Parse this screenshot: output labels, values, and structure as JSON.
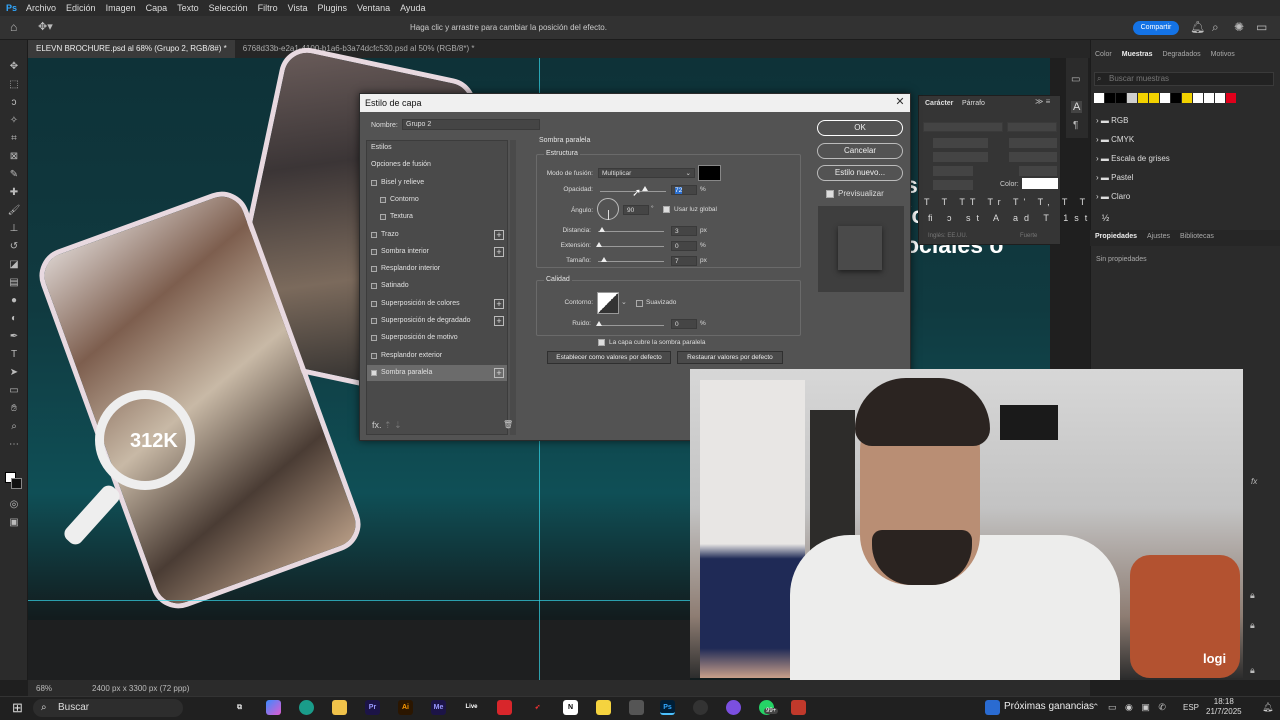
{
  "menubar": {
    "items": [
      "Archivo",
      "Edición",
      "Imagen",
      "Capa",
      "Texto",
      "Selección",
      "Filtro",
      "Vista",
      "Plugins",
      "Ventana",
      "Ayuda"
    ]
  },
  "optbar": {
    "hint": "Haga clic y arrastre para cambiar la posición del efecto.",
    "share_label": "Compartir"
  },
  "tabs": [
    {
      "label": "ELEVN BROCHURE.psd al 68% (Grupo 2, RGB/8#) *",
      "active": true
    },
    {
      "label": "6768d33b-e2a1-4100-b1a6-b3a74dcfc530.psd al 50% (RGB/8*) *",
      "active": false
    }
  ],
  "canvas": {
    "headline": "stas y/o\n/o recursos\nociales o",
    "magnifier_text": "312K"
  },
  "status": {
    "zoom": "68%",
    "size": "2400 px x 3300 px (72 ppp)"
  },
  "right_panel": {
    "tabs": [
      "Color",
      "Muestras",
      "Degradados",
      "Motivos"
    ],
    "active_tab": "Muestras",
    "search_placeholder": "Buscar muestras",
    "swatch_colors": [
      "#ffffff",
      "#000000",
      "#000000",
      "#cfcfcf",
      "#f2d200",
      "#f2d200",
      "#ffffff",
      "#000000",
      "#f2d200",
      "#ffffff",
      "#ffffff",
      "#ffffff",
      "#e0001b"
    ],
    "folders": [
      "RGB",
      "CMYK",
      "Escala de grises",
      "Pastel",
      "Claro"
    ],
    "prop_tabs": [
      "Propiedades",
      "Ajustes",
      "Bibliotecas"
    ],
    "prop_empty": "Sin propiedades"
  },
  "char_panel": {
    "tabs": [
      "Carácter",
      "Párrafo"
    ],
    "color_label": "Color:",
    "lang": "Inglés: EE.UU.",
    "antialias": "Fuerte",
    "glyphs": "T T TT Tr T' T, T T"
  },
  "dialog": {
    "title": "Estilo de capa",
    "name_label": "Nombre:",
    "name_value": "Grupo 2",
    "styles": [
      {
        "label": "Estilos",
        "checkbox": false,
        "plus": false,
        "indent": 0,
        "selected": false
      },
      {
        "label": "Opciones de fusión",
        "checkbox": false,
        "plus": false,
        "indent": 0,
        "selected": false
      },
      {
        "label": "Bisel y relieve",
        "checkbox": true,
        "plus": false,
        "indent": 0,
        "selected": false
      },
      {
        "label": "Contorno",
        "checkbox": true,
        "plus": false,
        "indent": 1,
        "selected": false
      },
      {
        "label": "Textura",
        "checkbox": true,
        "plus": false,
        "indent": 1,
        "selected": false
      },
      {
        "label": "Trazo",
        "checkbox": true,
        "plus": true,
        "indent": 0,
        "selected": false
      },
      {
        "label": "Sombra interior",
        "checkbox": true,
        "plus": true,
        "indent": 0,
        "selected": false
      },
      {
        "label": "Resplandor interior",
        "checkbox": true,
        "plus": false,
        "indent": 0,
        "selected": false
      },
      {
        "label": "Satinado",
        "checkbox": true,
        "plus": false,
        "indent": 0,
        "selected": false
      },
      {
        "label": "Superposición de colores",
        "checkbox": true,
        "plus": true,
        "indent": 0,
        "selected": false
      },
      {
        "label": "Superposición de degradado",
        "checkbox": true,
        "plus": true,
        "indent": 0,
        "selected": false
      },
      {
        "label": "Superposición de motivo",
        "checkbox": true,
        "plus": false,
        "indent": 0,
        "selected": false
      },
      {
        "label": "Resplandor exterior",
        "checkbox": true,
        "plus": false,
        "indent": 0,
        "selected": false
      },
      {
        "label": "Sombra paralela",
        "checkbox": true,
        "checked": true,
        "plus": true,
        "indent": 0,
        "selected": true
      }
    ],
    "fx_label": "fx.",
    "section_title": "Sombra paralela",
    "structure_title": "Estructura",
    "blend_label": "Modo de fusión:",
    "blend_value": "Multiplicar",
    "shadow_color": "#000000",
    "opacity_label": "Opacidad:",
    "opacity_value": "72",
    "angle_label": "Ángulo:",
    "angle_value": "90",
    "global_light": "Usar luz global",
    "distance_label": "Distancia:",
    "distance_value": "3",
    "spread_label": "Extensión:",
    "spread_value": "0",
    "size_label": "Tamaño:",
    "size_value": "7",
    "quality_title": "Calidad",
    "contour_label": "Contorno:",
    "antialias_label": "Suavizado",
    "noise_label": "Ruido:",
    "noise_value": "0",
    "knockout": "La capa cubre la sombra paralela",
    "btn_default": "Establecer como valores por defecto",
    "btn_reset": "Restaurar valores por defecto",
    "ok": "OK",
    "cancel": "Cancelar",
    "new_style": "Estilo nuevo...",
    "preview": "Previsualizar",
    "unit_percent": "%",
    "unit_px": "px",
    "unit_deg": "°"
  },
  "webcam": {
    "logo": "logi"
  },
  "taskbar": {
    "search": "Buscar",
    "news": "Próximas ganancias",
    "lang": "ESP",
    "time": "18:18",
    "date": "21/7/2025",
    "badge": "99+"
  }
}
